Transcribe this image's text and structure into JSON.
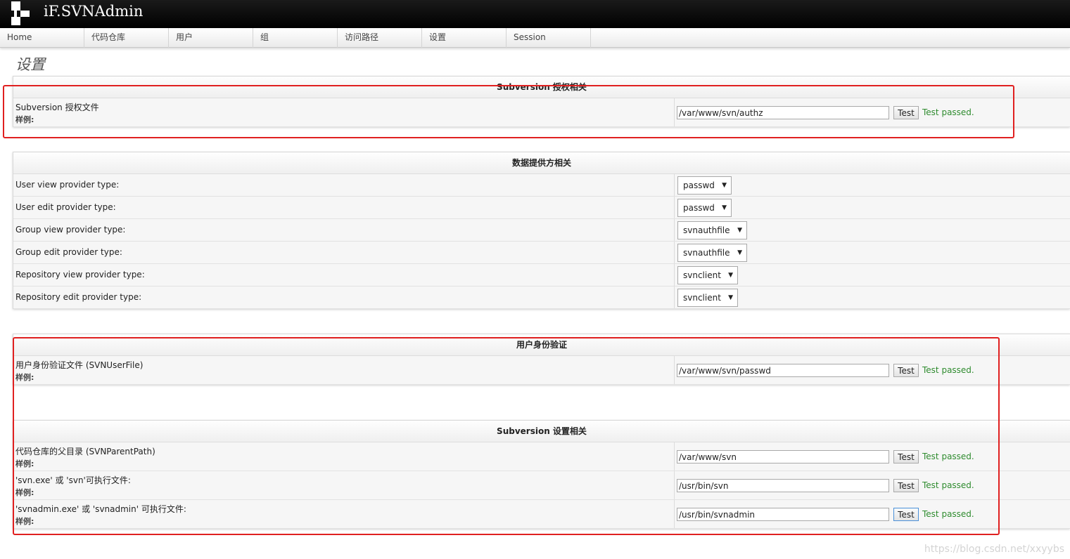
{
  "app": {
    "title": "iF.SVNAdmin"
  },
  "nav": {
    "items": [
      {
        "label": "Home"
      },
      {
        "label": "代码仓库"
      },
      {
        "label": "用户"
      },
      {
        "label": "组"
      },
      {
        "label": "访问路径"
      },
      {
        "label": "设置"
      },
      {
        "label": "Session"
      }
    ]
  },
  "page": {
    "title": "设置"
  },
  "authz_section": {
    "header": "Subversion 授权相关",
    "rows": [
      {
        "label": "Subversion 授权文件",
        "example_label": "样例:",
        "value": "/var/www/svn/authz",
        "button": "Test",
        "status": "Test passed."
      }
    ]
  },
  "provider_section": {
    "header": "数据提供方相关",
    "rows": [
      {
        "label": "User view provider type:",
        "selected": "passwd"
      },
      {
        "label": "User edit provider type:",
        "selected": "passwd"
      },
      {
        "label": "Group view provider type:",
        "selected": "svnauthfile"
      },
      {
        "label": "Group edit provider type:",
        "selected": "svnauthfile"
      },
      {
        "label": "Repository view provider type:",
        "selected": "svnclient"
      },
      {
        "label": "Repository edit provider type:",
        "selected": "svnclient"
      }
    ],
    "dropdown_arrow": "▼"
  },
  "auth_section": {
    "header": "用户身份验证",
    "rows": [
      {
        "label": "用户身份验证文件 (SVNUserFile)",
        "example_label": "样例:",
        "value": "/var/www/svn/passwd",
        "button": "Test",
        "status": "Test passed."
      }
    ]
  },
  "svn_section": {
    "header": "Subversion 设置相关",
    "rows": [
      {
        "label": "代码仓库的父目录 (SVNParentPath)",
        "example_label": "样例:",
        "value": "/var/www/svn",
        "button": "Test",
        "status": "Test passed."
      },
      {
        "label": "'svn.exe' 或 'svn'可执行文件:",
        "example_label": "样例:",
        "value": "/usr/bin/svn",
        "button": "Test",
        "status": "Test passed."
      },
      {
        "label": "'svnadmin.exe' 或 'svnadmin' 可执行文件:",
        "example_label": "样例:",
        "value": "/usr/bin/svnadmin",
        "button": "Test",
        "status": "Test passed."
      }
    ]
  },
  "colors": {
    "status_ok": "#2e8b2e",
    "highlight": "#e02020",
    "header_bg": "#000000"
  },
  "watermark": "https://blog.csdn.net/xxyybs"
}
